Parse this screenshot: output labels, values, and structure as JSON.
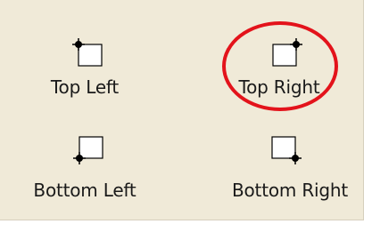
{
  "anchor_options": [
    {
      "id": "top-left",
      "label": "Top Left",
      "anchor": "top-left"
    },
    {
      "id": "top-right",
      "label": "Top Right",
      "anchor": "top-right"
    },
    {
      "id": "bottom-left",
      "label": "Bottom Left",
      "anchor": "bottom-left"
    },
    {
      "id": "bottom-right",
      "label": "Bottom Right",
      "anchor": "bottom-right"
    }
  ],
  "highlighted_option": "top-right",
  "colors": {
    "panel_background": "#f0ead8",
    "highlight_ring": "#e3131b",
    "icon_stroke": "#000000",
    "icon_fill": "#ffffff"
  }
}
